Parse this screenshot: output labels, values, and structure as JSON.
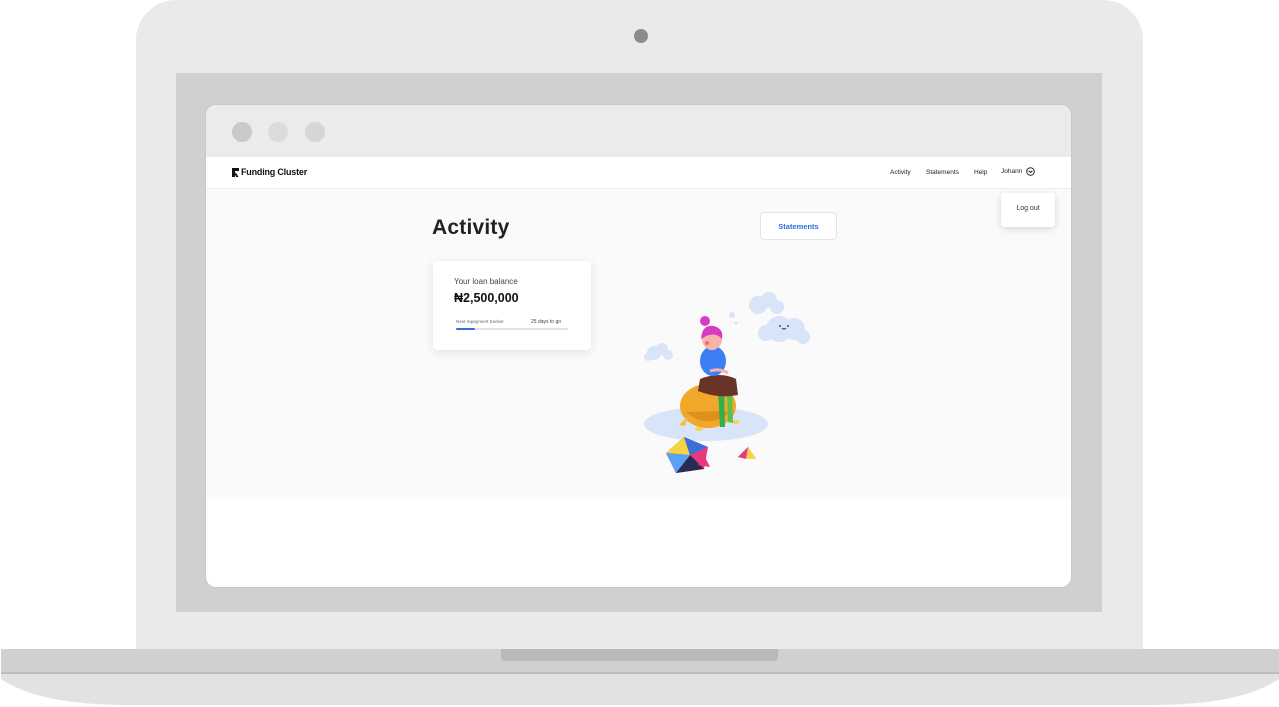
{
  "app": {
    "logo_text": "Funding Cluster"
  },
  "nav": {
    "links": [
      "Activity",
      "Statements",
      "Help"
    ],
    "user_name": "Johann",
    "dropdown": {
      "logout_label": "Log out"
    }
  },
  "main": {
    "title": "Activity",
    "statements_button_label": "Statements",
    "loan_card": {
      "label": "Your loan balance",
      "amount": "₦2,500,000",
      "tracker_label": "Next repayment tracker",
      "tracker_days": "25 days to go",
      "tracker_progress": 0.17
    }
  },
  "colors": {
    "accent": "#2f6fdc"
  }
}
